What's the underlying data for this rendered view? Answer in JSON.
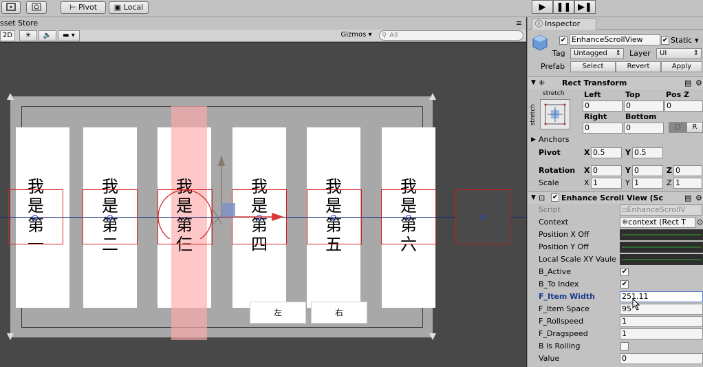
{
  "toolbar": {
    "pivot_label": "Pivot",
    "local_label": "Local"
  },
  "scene": {
    "tab_label": "sset Store",
    "mode_2d": "2D",
    "gizmos_label": "Gizmos",
    "search_placeholder": "All",
    "cards": [
      {
        "text": "我是第一"
      },
      {
        "text": "我是第二"
      },
      {
        "text": "我是第仨"
      },
      {
        "text": "我是第四"
      },
      {
        "text": "我是第五"
      },
      {
        "text": "我是第六"
      }
    ],
    "button_left": "左",
    "button_right": "右"
  },
  "inspector": {
    "tab_label": "Inspector",
    "object_name": "EnhanceScrollView",
    "static_label": "Static",
    "tag_label": "Tag",
    "tag_value": "Untagged",
    "layer_label": "Layer",
    "layer_value": "UI",
    "prefab_label": "Prefab",
    "prefab_select": "Select",
    "prefab_revert": "Revert",
    "prefab_apply": "Apply",
    "rect_transform": {
      "title": "Rect Transform",
      "stretch_top": "stretch",
      "stretch_side": "stretch",
      "left_label": "Left",
      "top_label": "Top",
      "posz_label": "Pos Z",
      "left_value": "0",
      "top_value": "0",
      "posz_value": "0",
      "right_label": "Right",
      "bottom_label": "Bottom",
      "right_value": "0",
      "bottom_value": "0",
      "r_button": "R",
      "anchors_label": "Anchors",
      "pivot_label": "Pivot",
      "pivot_x": "0.5",
      "pivot_y": "0.5",
      "rotation_label": "Rotation",
      "rot_x": "0",
      "rot_y": "0",
      "rot_z": "0",
      "scale_label": "Scale",
      "scale_x": "1",
      "scale_y": "1",
      "scale_z": "1",
      "x": "X",
      "y": "Y",
      "z": "Z"
    },
    "script_component": {
      "title": "Enhance Scroll View (Sc",
      "script_label": "Script",
      "script_value": "EnhanceScrollV",
      "context_label": "Context",
      "context_value": "context (Rect T",
      "pos_x_label": "Position X Off",
      "pos_y_label": "Position Y Off",
      "local_scale_label": "Local Scale XY Vaule",
      "b_active_label": "B_Active",
      "b_to_index_label": "B_To Index",
      "f_item_width_label": "F_Item Width",
      "f_item_width_value": "251.11",
      "f_item_space_label": "F_Item Space",
      "f_item_space_value": "95",
      "f_rollspeed_label": "F_Rollspeed",
      "f_rollspeed_value": "1",
      "f_dragspeed_label": "F_Dragspeed",
      "f_dragspeed_value": "1",
      "b_is_rolling_label": "B Is Rolling",
      "value_label": "Value",
      "value_value": "0"
    }
  }
}
